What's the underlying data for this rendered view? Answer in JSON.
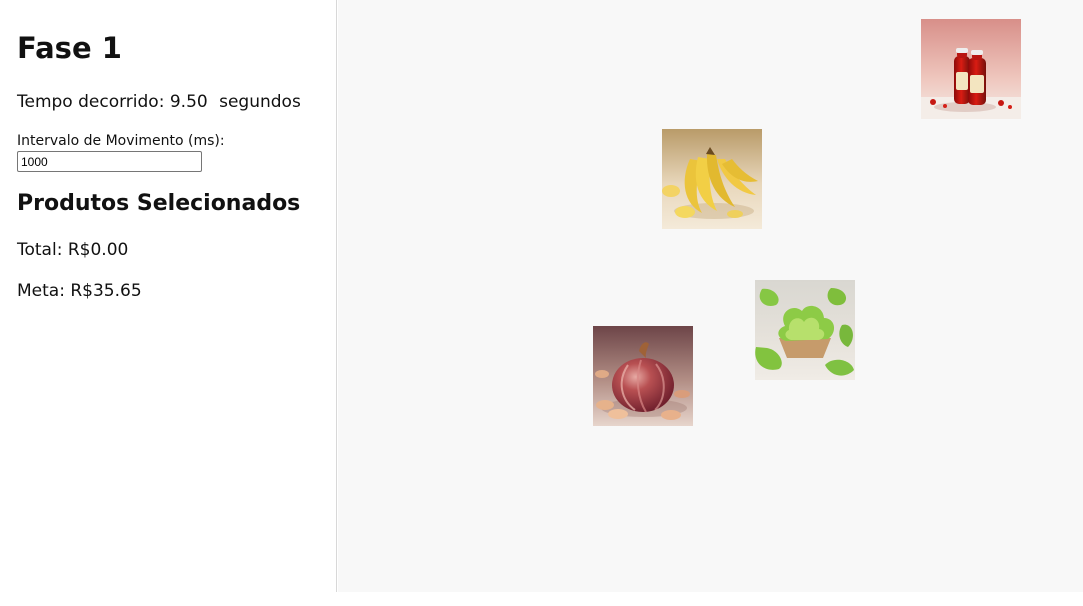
{
  "sidebar": {
    "title": "Fase 1",
    "elapsed_label": "Tempo decorrido:",
    "elapsed_value": "9.50",
    "elapsed_unit": "segundos",
    "interval_label": "Intervalo de Movimento (ms):",
    "interval_value": "1000",
    "selected_title": "Produtos Selecionados",
    "total_label": "Total:",
    "total_value": "R$0.00",
    "goal_label": "Meta:",
    "goal_value": "R$35.65"
  },
  "products": [
    {
      "id": "ketchup",
      "icon": "ketchup-bottles-image"
    },
    {
      "id": "banana",
      "icon": "banana-bunch-image"
    },
    {
      "id": "lettuce",
      "icon": "lettuce-image"
    },
    {
      "id": "onion",
      "icon": "red-onion-image"
    }
  ],
  "colors": {
    "sidebar_bg": "#ffffff",
    "play_area_bg": "#f8f8f8",
    "divider": "#d8d8d8",
    "text": "#111111"
  }
}
